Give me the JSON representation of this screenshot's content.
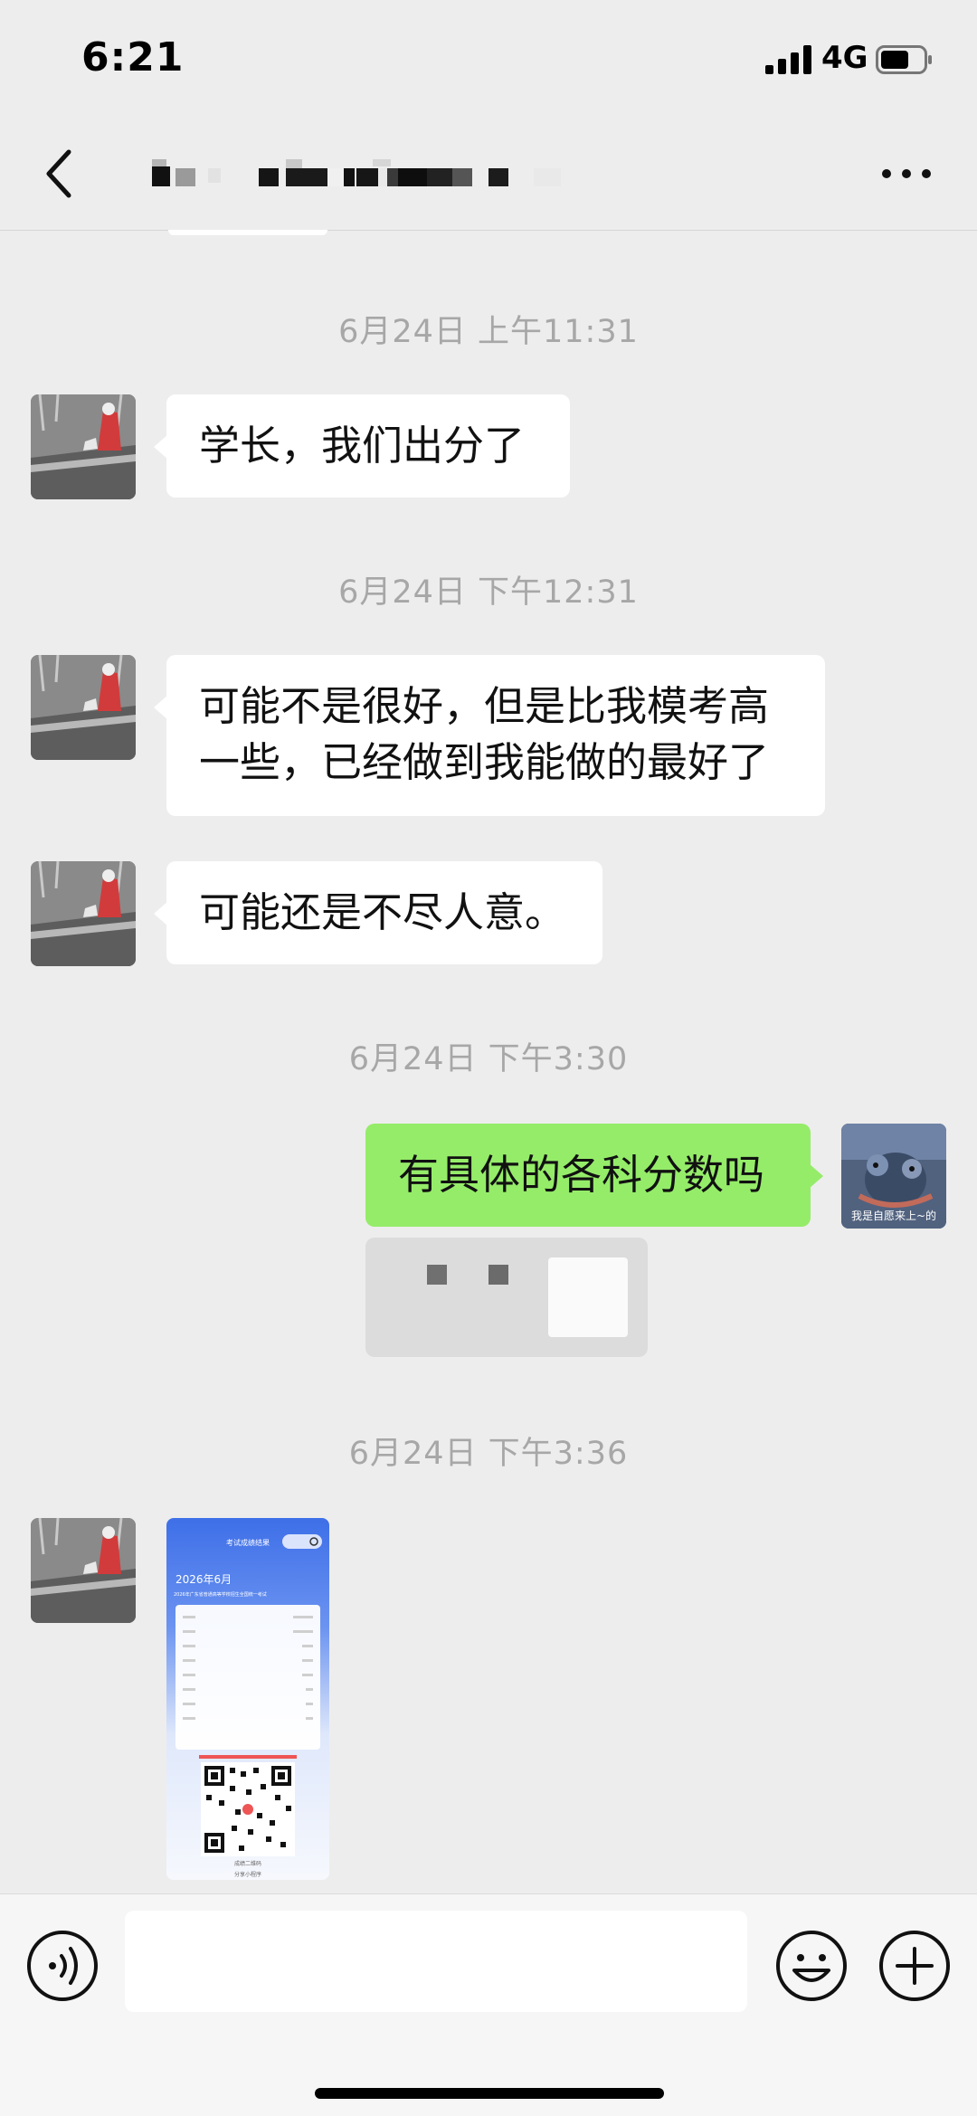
{
  "status_bar": {
    "time": "6:21",
    "network": "4G"
  },
  "nav": {
    "title": "",
    "title_redacted": true
  },
  "messages": [
    {
      "type": "timestamp",
      "text": "6月24日 上午11:31"
    },
    {
      "type": "text",
      "side": "left",
      "text": "学长，我们出分了"
    },
    {
      "type": "timestamp",
      "text": "6月24日 下午12:31"
    },
    {
      "type": "text",
      "side": "left",
      "text": "可能不是很好，但是比我模考高一些，已经做到我能做的最好了"
    },
    {
      "type": "text",
      "side": "left",
      "text": "可能还是不尽人意。"
    },
    {
      "type": "timestamp",
      "text": "6月24日 下午3:30"
    },
    {
      "type": "text",
      "side": "right",
      "text": "有具体的各科分数吗"
    },
    {
      "type": "quote",
      "side": "right",
      "redacted": true
    },
    {
      "type": "timestamp",
      "text": "6月24日 下午3:36"
    },
    {
      "type": "image",
      "side": "left"
    }
  ],
  "score_card": {
    "header": "考试成绩结果",
    "year": "2026年6月",
    "subtitle": "2026年广东省普通高等学校招生全国统一考试",
    "qr_label": "成绩二维码",
    "footer": "分享小程序"
  },
  "self_avatar_caption": "我是自愿来上~的",
  "input_bar": {
    "placeholder": ""
  },
  "colors": {
    "background": "#ededed",
    "bubble_self": "#95ec69",
    "bubble_other": "#ffffff",
    "timestamp": "#a7a7a7"
  },
  "icons": {
    "back": "chevron-left-icon",
    "more": "more-dots-icon",
    "voice": "voice-icon",
    "emoji": "emoji-icon",
    "plus": "plus-icon"
  }
}
